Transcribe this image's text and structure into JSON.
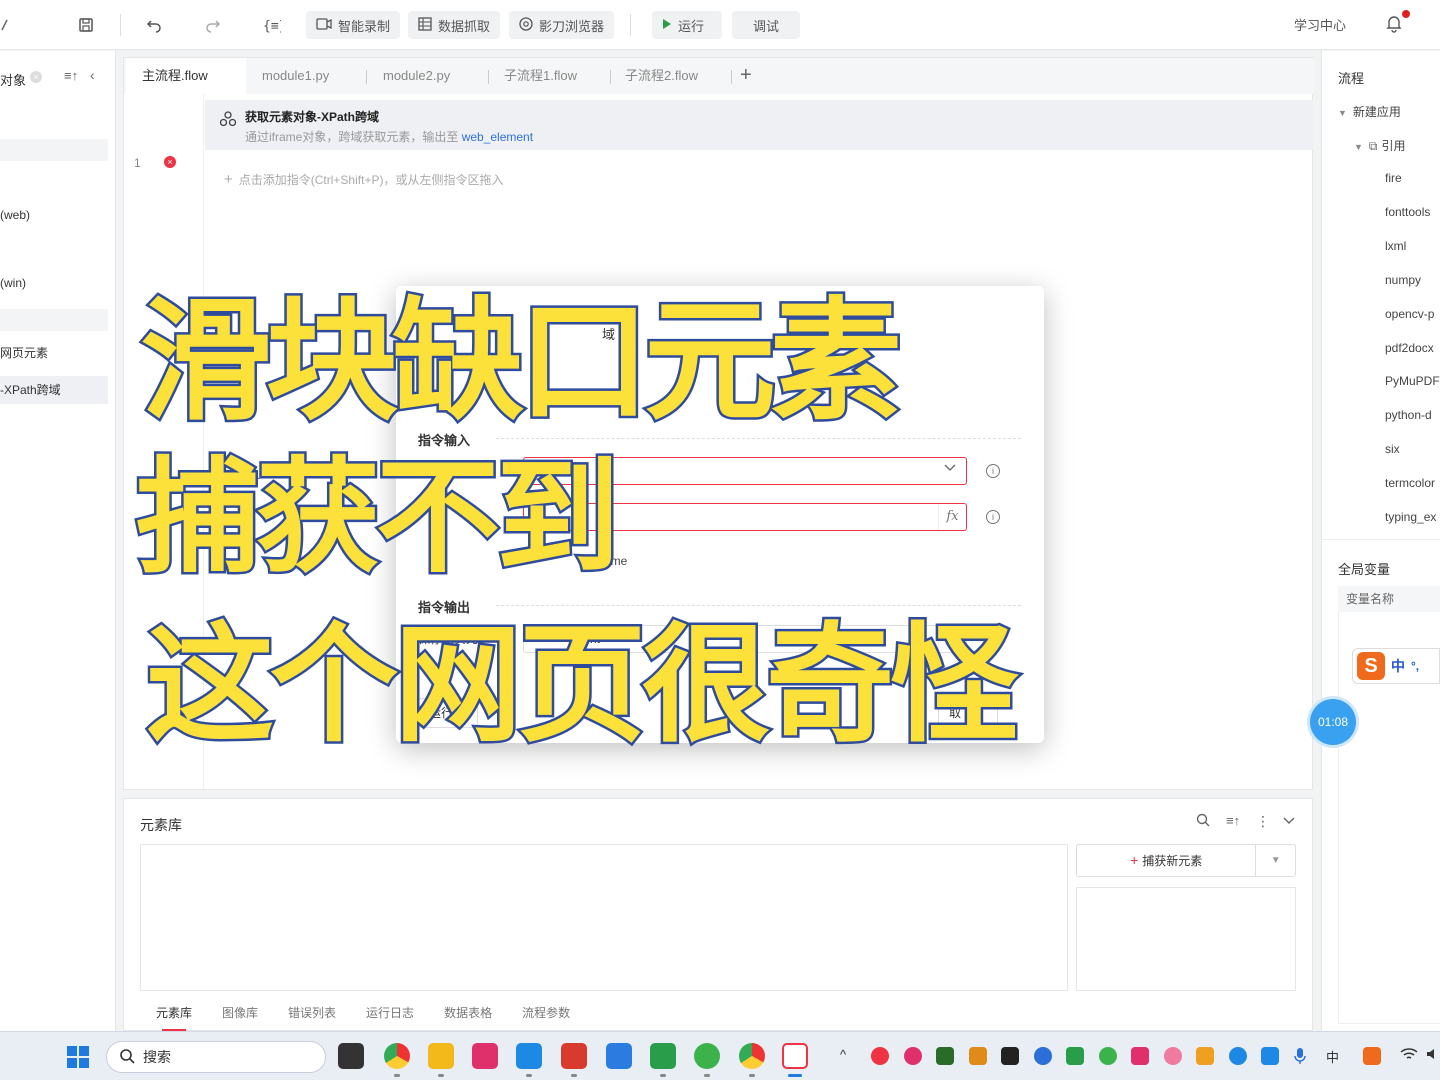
{
  "toolbar": {
    "smart_record": "智能录制",
    "data_capture": "数据抓取",
    "shadow_browser": "影刀浏览器",
    "run": "运行",
    "debug": "调试",
    "learning_center": "学习中心"
  },
  "left_panel": {
    "header": "对象",
    "items": [
      "(web)",
      "(win)",
      "网页元素",
      "-XPath跨域"
    ]
  },
  "tabs": [
    "主流程.flow",
    "module1.py",
    "module2.py",
    "子流程1.flow",
    "子流程2.flow"
  ],
  "editor": {
    "line_number": "1",
    "command_title": "获取元素对象-XPath跨域",
    "command_desc": "通过iframe对象，跨域获取元素，输出至",
    "command_var": "web_element",
    "add_hint": "点击添加指令(Ctrl+Shift+P)，或从左侧指令区拖入"
  },
  "dialog": {
    "title_fragment": "域",
    "sub_fragment": "览",
    "input_section": "指令输入",
    "output_section": "指令输出",
    "iframe_label": "ame对象",
    "option_fragment": "ame",
    "output_label": "保存网页元",
    "output_value": "nt",
    "run_button": "运行指",
    "right_button": "取"
  },
  "overlay": {
    "line1": "滑块缺口元素",
    "line2": "捕获不到",
    "line3": "这个网页很奇怪"
  },
  "right_panel": {
    "title": "流程",
    "root": "新建应用",
    "ref": "引用",
    "packages": [
      "fire",
      "fonttools",
      "lxml",
      "numpy",
      "opencv-p",
      "pdf2docx",
      "PyMuPDF",
      "python-d",
      "six",
      "termcolor",
      "typing_ex"
    ],
    "global_vars": "全局变量",
    "var_name_header": "变量名称"
  },
  "ime": {
    "zh": "中",
    "punct": "°,"
  },
  "timer": "01:08",
  "bottom_panel": {
    "title": "元素库",
    "capture_button": "捕获新元素",
    "tabs": [
      "元素库",
      "图像库",
      "错误列表",
      "运行日志",
      "数据表格",
      "流程参数"
    ]
  },
  "taskbar": {
    "search_placeholder": "搜索",
    "tray_lang": "中"
  },
  "colors": {
    "accent_red": "#e33344",
    "link_blue": "#2f6fdb",
    "overlay_fill": "#fbe13a",
    "overlay_stroke": "#2f4b9c",
    "timer_blue": "#3aa0f0"
  }
}
